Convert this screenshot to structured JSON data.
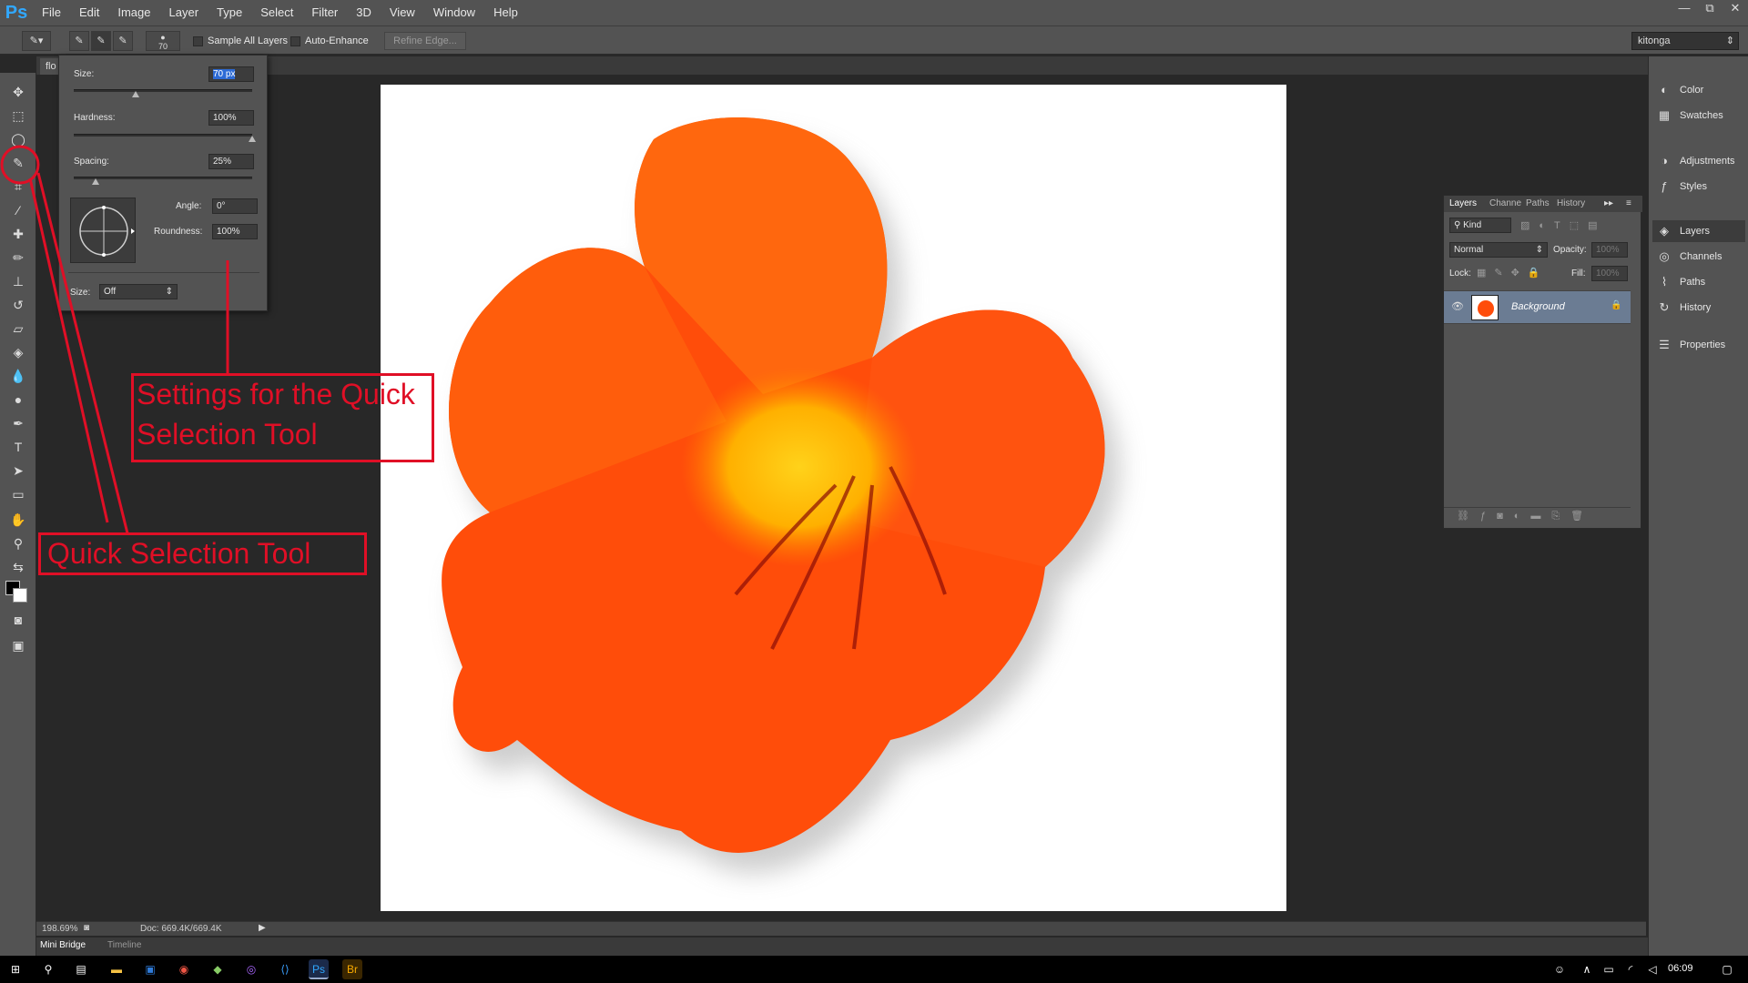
{
  "app": {
    "logo": "Ps",
    "menus": [
      "File",
      "Edit",
      "Image",
      "Layer",
      "Type",
      "Select",
      "Filter",
      "3D",
      "View",
      "Window",
      "Help"
    ],
    "window_controls": [
      "—",
      "⧉",
      "✕"
    ]
  },
  "options_bar": {
    "brush_size": "70",
    "sample_all_layers": "Sample All Layers",
    "auto_enhance": "Auto-Enhance",
    "refine_edge": "Refine Edge...",
    "workspace": "kitonga"
  },
  "document": {
    "tab": "flo",
    "zoom": "198.69%",
    "doc_info": "Doc: 669.4K/669.4K"
  },
  "brush_popup": {
    "size_label": "Size:",
    "size_value": "70 px",
    "hardness_label": "Hardness:",
    "hardness_value": "100%",
    "spacing_label": "Spacing:",
    "spacing_value": "25%",
    "angle_label": "Angle:",
    "angle_value": "0°",
    "roundness_label": "Roundness:",
    "roundness_value": "100%",
    "pen_size_label": "Size:",
    "pen_size_value": "Off"
  },
  "layers_panel": {
    "tabs": [
      "Layers",
      "Channe",
      "Paths",
      "History"
    ],
    "kind": "Kind",
    "blend_mode": "Normal",
    "opacity_label": "Opacity:",
    "opacity_value": "100%",
    "lock_label": "Lock:",
    "fill_label": "Fill:",
    "fill_value": "100%",
    "layer_name": "Background"
  },
  "right_dock": {
    "items": [
      "Color",
      "Swatches",
      "Adjustments",
      "Styles",
      "Layers",
      "Channels",
      "Paths",
      "History",
      "Properties"
    ]
  },
  "bottom": {
    "mini_bridge": "Mini Bridge",
    "timeline": "Timeline"
  },
  "taskbar": {
    "time": "06:09"
  },
  "annotations": {
    "settings_line1": "Settings for the Quick",
    "settings_line2": "Selection Tool",
    "tool_label": "Quick Selection Tool",
    "color": "#e00f26"
  },
  "colors": {
    "ui": "#535353",
    "canvas_bg": "#282828",
    "petal": "#ff4d0a",
    "selected_layer": "#6b7c93"
  }
}
